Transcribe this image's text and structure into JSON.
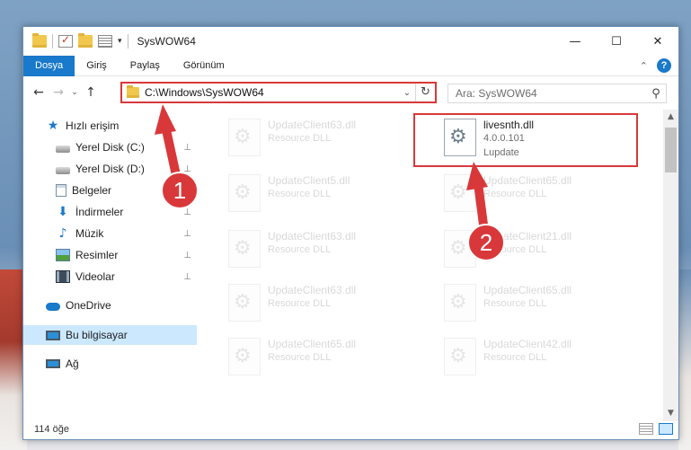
{
  "window": {
    "title": "SysWOW64"
  },
  "window_controls": {
    "minimize": "—",
    "maximize": "☐",
    "close": "✕"
  },
  "ribbon": {
    "tabs": [
      {
        "label": "Dosya",
        "active": true
      },
      {
        "label": "Giriş"
      },
      {
        "label": "Paylaş"
      },
      {
        "label": "Görünüm"
      }
    ],
    "help": "?",
    "collapse": "⌃"
  },
  "nav": {
    "back": "←",
    "forward": "→",
    "recent": "⌄",
    "up": "↑",
    "address": "C:\\Windows\\SysWOW64",
    "address_drop": "⌄",
    "refresh": "↻",
    "search_placeholder": "Ara: SysWOW64",
    "search_icon": "⚲"
  },
  "sidebar": {
    "items": [
      {
        "label": "Hızlı erişim",
        "icon": "star-icon"
      },
      {
        "label": "Yerel Disk (C:)",
        "icon": "drive-icon",
        "pinned": true
      },
      {
        "label": "Yerel Disk (D:)",
        "icon": "drive-icon",
        "pinned": true
      },
      {
        "label": "Belgeler",
        "icon": "documents-icon",
        "pinned": true
      },
      {
        "label": "İndirmeler",
        "icon": "downloads-icon",
        "pinned": true
      },
      {
        "label": "Müzik",
        "icon": "music-icon",
        "pinned": true
      },
      {
        "label": "Resimler",
        "icon": "pictures-icon",
        "pinned": true
      },
      {
        "label": "Videolar",
        "icon": "videos-icon",
        "pinned": true
      },
      {
        "label": "OneDrive",
        "icon": "onedrive-icon"
      },
      {
        "label": "Bu bilgisayar",
        "icon": "this-pc-icon",
        "selected": true
      },
      {
        "label": "Ağ",
        "icon": "network-icon"
      }
    ],
    "pin_glyph": "📌"
  },
  "files": {
    "highlighted": {
      "name": "livesnth.dll",
      "version": "4.0.0.101",
      "company": "Lupdate"
    },
    "ghost": [
      {
        "name": "UpdateClient63.dll",
        "desc": "Resource DLL"
      },
      {
        "name": "UpdateClient5.dll",
        "desc": "Resource DLL"
      },
      {
        "name": "UpdateClient65.dll",
        "desc": "Resource DLL"
      },
      {
        "name": "UpdateClient63.dll",
        "desc": "Resource DLL"
      },
      {
        "name": "UpdateClient21.dll",
        "desc": "Resource DLL"
      },
      {
        "name": "UpdateClient63.dll",
        "desc": "Resource DLL"
      },
      {
        "name": "UpdateClient65.dll",
        "desc": "Resource DLL"
      },
      {
        "name": "UpdateClient65.dll",
        "desc": "Resource DLL"
      },
      {
        "name": "UpdateClient42.dll",
        "desc": "Resource DLL"
      }
    ]
  },
  "status": {
    "count": "114 öğe"
  },
  "annotations": {
    "step1": "1",
    "step2": "2",
    "color": "#d9383a"
  }
}
